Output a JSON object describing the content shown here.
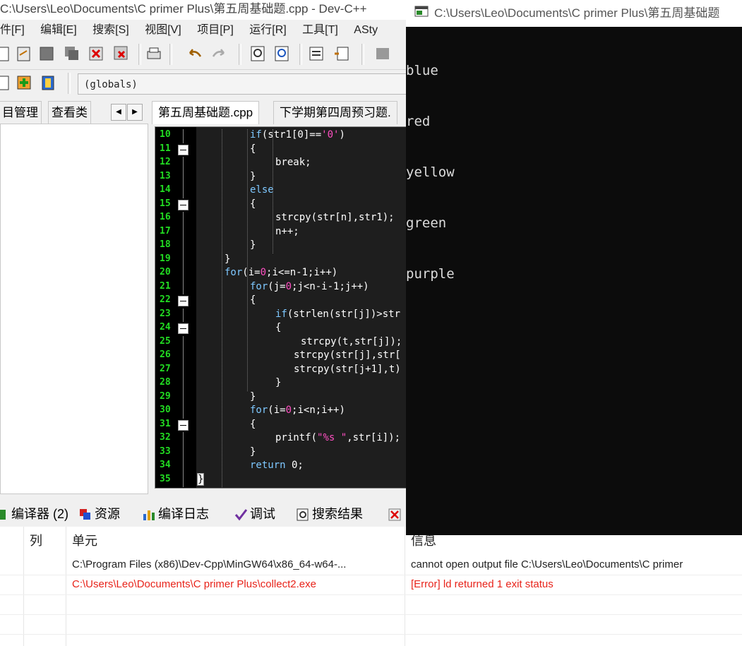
{
  "ide": {
    "title": "C:\\Users\\Leo\\Documents\\C primer Plus\\第五周基础题.cpp - Dev-C++",
    "menu": [
      "件[F]",
      "编辑[E]",
      "搜索[S]",
      "视图[V]",
      "项目[P]",
      "运行[R]",
      "工具[T]",
      "ASty"
    ],
    "globals": "(globals)",
    "left_tabs": [
      "目管理",
      "查看类"
    ],
    "editor_tabs": [
      "第五周基础题.cpp",
      "下学期第四周预习题."
    ]
  },
  "code_lines": [
    {
      "n": "10",
      "text": "if(str1[0]=='0')"
    },
    {
      "n": "11",
      "text": "{"
    },
    {
      "n": "12",
      "text": "break;"
    },
    {
      "n": "13",
      "text": "}"
    },
    {
      "n": "14",
      "text": "else"
    },
    {
      "n": "15",
      "text": "{"
    },
    {
      "n": "16",
      "text": "strcpy(str[n],str1);"
    },
    {
      "n": "17",
      "text": "n++;"
    },
    {
      "n": "18",
      "text": "}"
    },
    {
      "n": "19",
      "text": "}"
    },
    {
      "n": "20",
      "text": "for(i=0;i<=n-1;i++)"
    },
    {
      "n": "21",
      "text": "for(j=0;j<n-i-1;j++)"
    },
    {
      "n": "22",
      "text": "{"
    },
    {
      "n": "23",
      "text": "if(strlen(str[j])>str"
    },
    {
      "n": "24",
      "text": "{"
    },
    {
      "n": "25",
      "text": "strcpy(t,str[j]);"
    },
    {
      "n": "26",
      "text": "strcpy(str[j],str["
    },
    {
      "n": "27",
      "text": "strcpy(str[j+1],t)"
    },
    {
      "n": "28",
      "text": "}"
    },
    {
      "n": "29",
      "text": "}"
    },
    {
      "n": "30",
      "text": "for(i=0;i<n;i++)"
    },
    {
      "n": "31",
      "text": "{"
    },
    {
      "n": "32",
      "text": "printf(\"%s \",str[i]);"
    },
    {
      "n": "33",
      "text": "}"
    },
    {
      "n": "34",
      "text": "return 0;"
    },
    {
      "n": "35",
      "text": "}"
    }
  ],
  "bottom_tabs": [
    "编译器 (2)",
    "资源",
    "编译日志",
    "调试",
    "搜索结果"
  ],
  "messages": {
    "headers": {
      "col": "列",
      "unit": "单元",
      "info": "信息"
    },
    "rows": [
      {
        "unit": "C:\\Program Files (x86)\\Dev-Cpp\\MinGW64\\x86_64-w64-...",
        "info": "cannot open output file C:\\Users\\Leo\\Documents\\C primer",
        "color": "#222222"
      },
      {
        "unit": "C:\\Users\\Leo\\Documents\\C primer Plus\\collect2.exe",
        "info": "[Error] ld returned 1 exit status",
        "color": "#e8231a"
      }
    ]
  },
  "console": {
    "title": "C:\\Users\\Leo\\Documents\\C primer Plus\\第五周基础题",
    "output": [
      "blue",
      "red",
      "yellow",
      "green",
      "purple"
    ]
  }
}
